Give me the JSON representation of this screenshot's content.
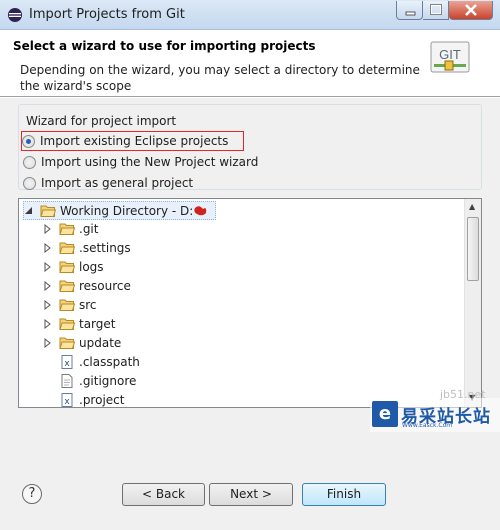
{
  "window": {
    "title": "Import Projects from Git"
  },
  "header": {
    "title": "Select a wizard to use for importing projects",
    "description": "Depending on the wizard, you may select a directory to determine the wizard's scope",
    "logo_text": "GIT"
  },
  "wizard_group": {
    "legend": "Wizard for project import",
    "options": [
      {
        "label": "Import existing Eclipse projects",
        "selected": true
      },
      {
        "label": "Import using the New Project wizard",
        "selected": false
      },
      {
        "label": "Import as general project",
        "selected": false
      }
    ]
  },
  "tree": {
    "root": {
      "label": "Working Directory - D:",
      "expanded": true
    },
    "items": [
      {
        "label": ".git",
        "type": "folder"
      },
      {
        "label": ".settings",
        "type": "folder"
      },
      {
        "label": "logs",
        "type": "folder"
      },
      {
        "label": "resource",
        "type": "folder"
      },
      {
        "label": "src",
        "type": "folder"
      },
      {
        "label": "target",
        "type": "folder"
      },
      {
        "label": "update",
        "type": "folder"
      },
      {
        "label": ".classpath",
        "type": "xml-file"
      },
      {
        "label": ".gitignore",
        "type": "text-file"
      },
      {
        "label": ".project",
        "type": "xml-file"
      }
    ]
  },
  "buttons": {
    "help": "?",
    "back": "< Back",
    "next": "Next >",
    "finish": "Finish"
  },
  "watermark": {
    "url": "jb51.net",
    "brand": "易采站长站",
    "sub": "Www.Easck.Com"
  },
  "colors": {
    "selection_outline": "#e0282a",
    "accent": "#1f5aa8",
    "folder": "#e8b84a"
  }
}
